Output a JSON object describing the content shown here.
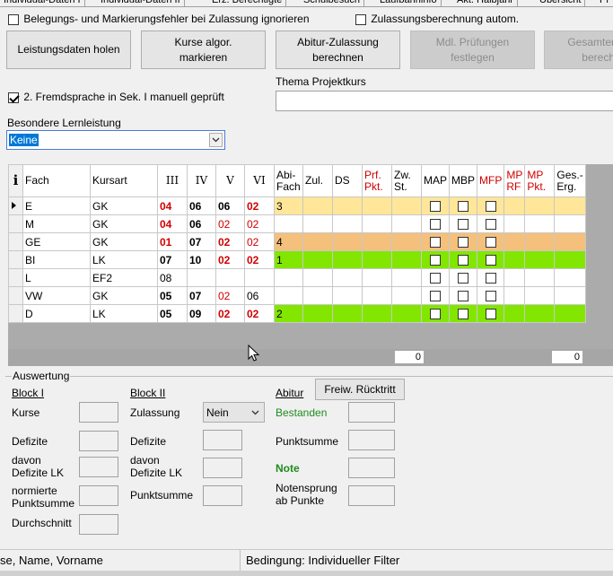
{
  "tabs": [
    "Individual-Daten I",
    "Individual-Daten II",
    "Erz. Berechtigte",
    "Schulbesuch",
    "Laufbahninfo",
    "Akt. Halbjahr",
    "Übersicht",
    "Pr"
  ],
  "options": {
    "ignore_errors_label": "Belegungs- und Markierungsfehler bei Zulassung ignorieren",
    "ignore_errors_checked": false,
    "auto_calc_label": "Zulassungsberechnung autom.",
    "auto_calc_checked": false,
    "second_language_label": "2. Fremdsprache in Sek. I manuell geprüft",
    "second_language_checked": true
  },
  "buttons": {
    "leistungsdaten": "Leistungsdaten holen",
    "kurse_line1": "Kurse algor.",
    "kurse_line2": "markieren",
    "abitur_line1": "Abitur-Zulassung",
    "abitur_line2": "berechnen",
    "mdl_line1": "Mdl. Prüfungen",
    "mdl_line2": "festlegen",
    "gesamt_line1": "Gesamter",
    "gesamt_line2": "berech"
  },
  "projektkurs": {
    "label": "Thema Projektkurs",
    "value": ""
  },
  "lernleistung": {
    "label": "Besondere Lernleistung",
    "selected": "Keine"
  },
  "grid": {
    "info_icon": "i",
    "headers": {
      "fach": "Fach",
      "kursart": "Kursart",
      "h3": "III",
      "h4": "IV",
      "h5": "V",
      "h6": "VI",
      "abifach_1": "Abi-",
      "abifach_2": "Fach",
      "zul": "Zul.",
      "ds": "DS",
      "prf_1": "Prf.",
      "prf_2": "Pkt.",
      "zw_1": "Zw.",
      "zw_2": "St.",
      "map": "MAP",
      "mbp": "MBP",
      "mfp": "MFP",
      "mprf_1": "MP",
      "mprf_2": "RF",
      "mppkt_1": "MP",
      "mppkt_2": "Pkt.",
      "ges_1": "Ges.-",
      "ges_2": "Erg."
    },
    "rows": [
      {
        "fach": "E",
        "kursart": "GK",
        "iii": "04",
        "iv": "06",
        "v": "06",
        "vi": "02",
        "abi": "3",
        "color": "y"
      },
      {
        "fach": "M",
        "kursart": "GK",
        "iii": "04",
        "iv": "06",
        "v": "02",
        "vi": "02",
        "abi": "",
        "color": ""
      },
      {
        "fach": "GE",
        "kursart": "GK",
        "iii": "01",
        "iv": "07",
        "v": "02",
        "vi": "02",
        "abi": "4",
        "color": "o"
      },
      {
        "fach": "BI",
        "kursart": "LK",
        "iii": "07",
        "iv": "10",
        "v": "02",
        "vi": "02",
        "abi": "1",
        "color": "g2"
      },
      {
        "fach": "L",
        "kursart": "EF2",
        "iii": "08",
        "iv": "",
        "v": "",
        "vi": "",
        "abi": "",
        "color": ""
      },
      {
        "fach": "VW",
        "kursart": "GK",
        "iii": "05",
        "iv": "07",
        "v": "02",
        "vi": "06",
        "abi": "",
        "color": ""
      },
      {
        "fach": "D",
        "kursart": "LK",
        "iii": "05",
        "iv": "09",
        "v": "02",
        "vi": "02",
        "abi": "2",
        "color": "g2"
      }
    ],
    "footer_left": "0",
    "footer_right": "0"
  },
  "auswertung": {
    "title": "Auswertung",
    "block1": {
      "title": "Block I",
      "kurse": "Kurse",
      "defizite": "Defizite",
      "davon_1": "davon",
      "davon_2": "Defizite LK",
      "norm_1": "normierte",
      "norm_2": "Punktsumme",
      "durchschnitt": "Durchschnitt"
    },
    "block2": {
      "title": "Block II",
      "zulassung": "Zulassung",
      "zulassung_value": "Nein",
      "defizite": "Defizite",
      "davon_1": "davon",
      "davon_2": "Defizite LK",
      "punktsumme": "Punktsumme"
    },
    "abitur": {
      "title": "Abitur",
      "ruecktritt_button": "Freiw. Rücktritt",
      "bestanden": "Bestanden",
      "punktsumme": "Punktsumme",
      "note": "Note",
      "sprung_1": "Notensprung",
      "sprung_2": "ab Punkte"
    }
  },
  "status": {
    "left": "se, Name, Vorname",
    "right": "Bedingung: Individueller Filter"
  }
}
